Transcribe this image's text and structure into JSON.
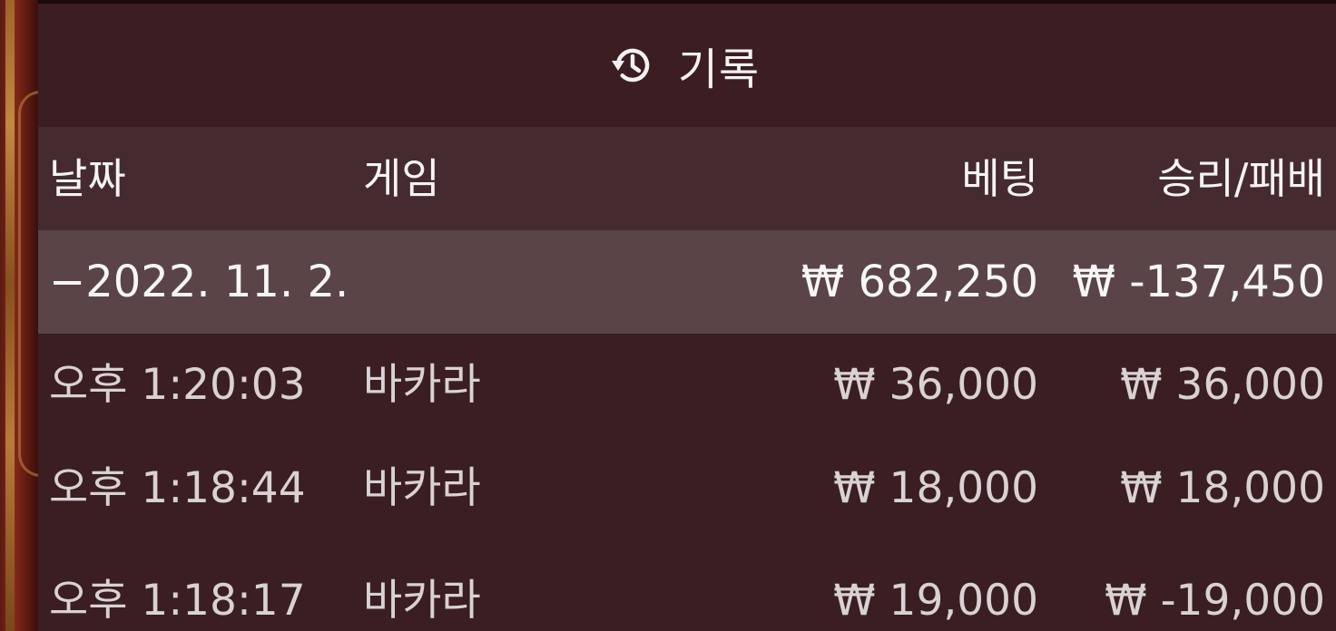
{
  "header": {
    "icon": "history-icon",
    "title": "기록"
  },
  "columns": {
    "date": "날짜",
    "game": "게임",
    "bet": "베팅",
    "result": "승리/패배"
  },
  "summary": {
    "date": "−2022. 11. 2.",
    "bet": "₩ 682,250",
    "result": "₩ -137,450"
  },
  "rows": [
    {
      "time": "오후 1:20:03",
      "game": "바카라",
      "bet": "₩ 36,000",
      "result": "₩ 36,000"
    },
    {
      "time": "오후 1:18:44",
      "game": "바카라",
      "bet": "₩ 18,000",
      "result": "₩ 18,000"
    },
    {
      "time": "오후 1:18:17",
      "game": "바카라",
      "bet": "₩ 19,000",
      "result": "₩ -19,000"
    }
  ]
}
